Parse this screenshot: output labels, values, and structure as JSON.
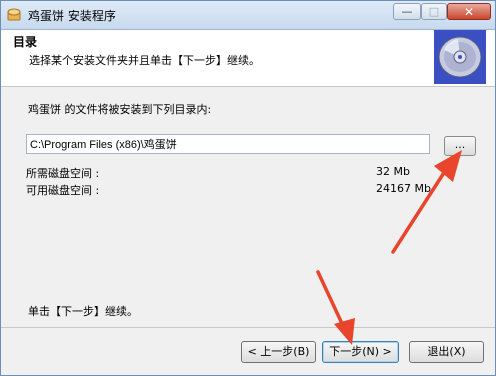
{
  "window": {
    "title": "鸡蛋饼 安装程序",
    "controls": {
      "minimize": "—",
      "maximize": "□",
      "close": "✕"
    }
  },
  "header": {
    "title": "目录",
    "subtitle": "选择某个安装文件夹并且单击【下一步】继续。",
    "icon": "cd-disc-icon"
  },
  "content": {
    "intro": "鸡蛋饼 的文件将被安装到下列目录内:",
    "install_path": "C:\\Program Files (x86)\\鸡蛋饼",
    "browse_label": "...",
    "required_space_label": "所需磁盘空间 :",
    "required_space_value": "32 Mb",
    "available_space_label": "可用磁盘空间 :",
    "available_space_value": "24167 Mb",
    "footer_note": "单击【下一步】继续。"
  },
  "buttons": {
    "back": "< 上一步(B)",
    "next": "下一步(N) >",
    "exit": "退出(X)"
  },
  "annotations": {
    "arrow_color": "#e8452c"
  }
}
